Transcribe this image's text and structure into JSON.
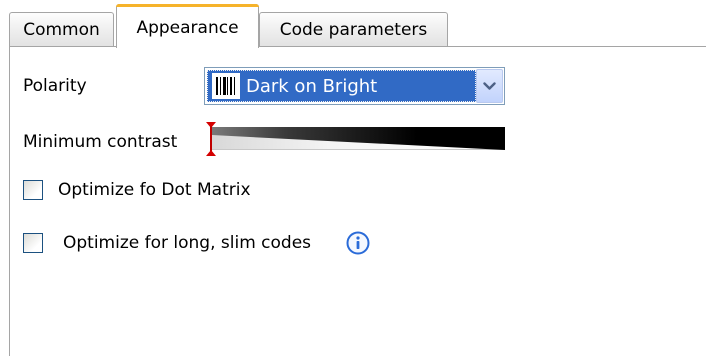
{
  "tabs": [
    {
      "label": "Common",
      "active": false
    },
    {
      "label": "Appearance",
      "active": true
    },
    {
      "label": "Code parameters",
      "active": false
    }
  ],
  "polarity": {
    "label": "Polarity",
    "selected": "Dark on Bright",
    "icon": "barcode-icon"
  },
  "contrast": {
    "label": "Minimum contrast",
    "value": 0
  },
  "options": [
    {
      "label": "Optimize fo Dot Matrix",
      "checked": false
    },
    {
      "label": "Optimize for long, slim codes",
      "checked": false,
      "icon": "info-icon"
    }
  ],
  "colors": {
    "active_tab_accent": "#f6b32a",
    "selection": "#316ac5",
    "info_icon": "#2a6bd8"
  }
}
